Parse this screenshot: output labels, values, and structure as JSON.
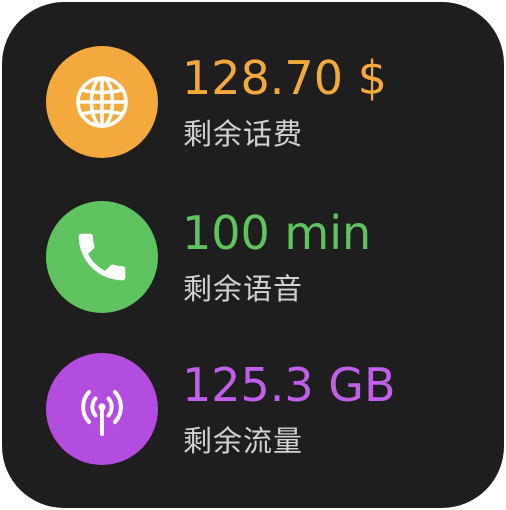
{
  "colors": {
    "background": "#1e1e1e",
    "label_text": "#d2d2d2",
    "balance_accent": "#f4a93c",
    "voice_accent": "#5fc45f",
    "data_accent": "#b24ddf"
  },
  "items": [
    {
      "icon": "globe-icon",
      "value": "128.70 $",
      "label": "剩余话费",
      "color": "#f4a93c"
    },
    {
      "icon": "phone-icon",
      "value": "100 min",
      "label": "剩余语音",
      "color": "#5fc45f"
    },
    {
      "icon": "antenna-icon",
      "value": "125.3 GB",
      "label": "剩余流量",
      "color": "#b24ddf"
    }
  ]
}
